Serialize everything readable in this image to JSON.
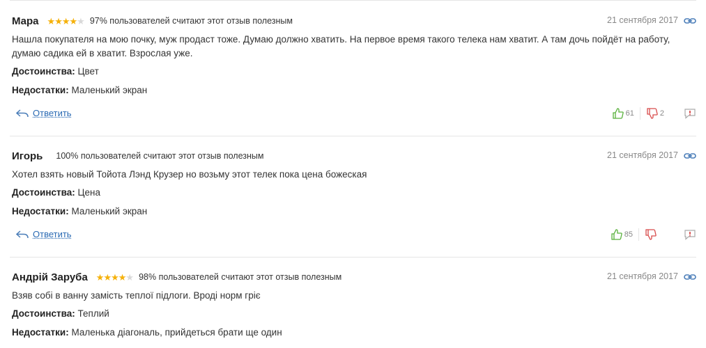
{
  "reviews": [
    {
      "author": "Мара",
      "rating": 4,
      "helpful_text": "97% пользователей считают этот отзыв полезным",
      "date": "21 сентября 2017",
      "text": "Нашла покупателя на мою почку, муж продаст тоже. Думаю должно хватить. На первое время такого телека нам хватит. А там дочь пойдёт на работу, думаю садика ей в хватит. Взрослая уже.",
      "pros_label": "Достоинства:",
      "pros": "Цвет",
      "cons_label": "Недостатки:",
      "cons": "Маленький экран",
      "reply_label": "Ответить",
      "likes": "61",
      "dislikes": "2"
    },
    {
      "author": "Игорь",
      "rating": null,
      "helpful_text": "100% пользователей считают этот отзыв полезным",
      "date": "21 сентября 2017",
      "text": "Хотел взять новый Тойота Лэнд Крузер но возьму этот телек пока цена божеская",
      "pros_label": "Достоинства:",
      "pros": "Цена",
      "cons_label": "Недостатки:",
      "cons": "Маленький экран",
      "reply_label": "Ответить",
      "likes": "85",
      "dislikes": ""
    },
    {
      "author": "Андрій Заруба",
      "rating": 4,
      "helpful_text": "98% пользователей считают этот отзыв полезным",
      "date": "21 сентября 2017",
      "text": "Взяв собі в ванну замість теплої підлоги. Вроді норм гріє",
      "pros_label": "Достоинства:",
      "pros": "Теплий",
      "cons_label": "Недостатки:",
      "cons": "Маленька діагональ, прийдеться брати ще один"
    }
  ],
  "colors": {
    "star": "#f5b10a",
    "star_empty": "#d9d9d9",
    "like": "#57b03a",
    "dislike": "#d84a4a",
    "link": "#2a6ab3"
  },
  "icons": [
    "star-icon",
    "link-icon",
    "reply-arrow-icon",
    "thumbs-up-icon",
    "thumbs-down-icon",
    "report-icon"
  ]
}
